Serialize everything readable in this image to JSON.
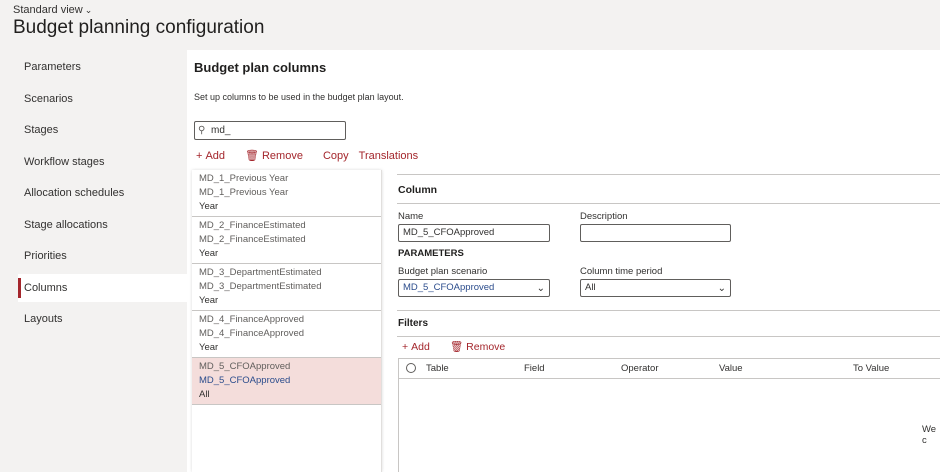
{
  "header": {
    "view_label": "Standard view",
    "page_title": "Budget planning configuration"
  },
  "sidebar": {
    "items": [
      {
        "label": "Parameters"
      },
      {
        "label": "Scenarios"
      },
      {
        "label": "Stages"
      },
      {
        "label": "Workflow stages"
      },
      {
        "label": "Allocation schedules"
      },
      {
        "label": "Stage allocations"
      },
      {
        "label": "Priorities"
      },
      {
        "label": "Columns"
      },
      {
        "label": "Layouts"
      }
    ],
    "active": "Columns"
  },
  "section": {
    "title": "Budget plan columns",
    "description": "Set up columns to be used in the budget plan layout."
  },
  "search": {
    "value": "md_"
  },
  "toolbar": {
    "add": "Add",
    "remove": "Remove",
    "copy": "Copy",
    "translations": "Translations"
  },
  "list": [
    {
      "name": "MD_1_Previous Year",
      "scenario": "MD_1_Previous Year",
      "period": "Year"
    },
    {
      "name": "MD_2_FinanceEstimated",
      "scenario": "MD_2_FinanceEstimated",
      "period": "Year"
    },
    {
      "name": "MD_3_DepartmentEstimated",
      "scenario": "MD_3_DepartmentEstimated",
      "period": "Year"
    },
    {
      "name": "MD_4_FinanceApproved",
      "scenario": "MD_4_FinanceApproved",
      "period": "Year"
    },
    {
      "name": "MD_5_CFOApproved",
      "scenario": "MD_5_CFOApproved",
      "period": "All"
    }
  ],
  "detail": {
    "heading": "Column",
    "name_label": "Name",
    "name_value": "MD_5_CFOApproved",
    "description_label": "Description",
    "description_value": "",
    "parameters_heading": "PARAMETERS",
    "scenario_label": "Budget plan scenario",
    "scenario_value": "MD_5_CFOApproved",
    "period_label": "Column time period",
    "period_value": "All"
  },
  "filters": {
    "heading": "Filters",
    "add": "Add",
    "remove": "Remove",
    "columns": [
      "Table",
      "Field",
      "Operator",
      "Value",
      "To Value"
    ],
    "empty_text": "We c"
  },
  "colors": {
    "accent": "#a4262c",
    "selected_row": "#f4dddb",
    "link_blue": "#2b4c8c"
  }
}
